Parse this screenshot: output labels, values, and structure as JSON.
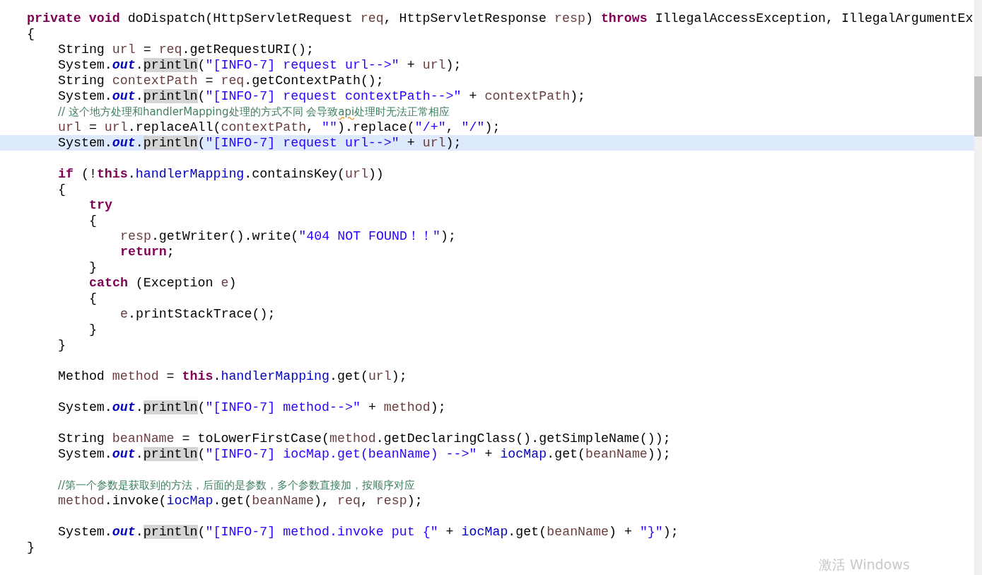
{
  "editor": {
    "lines": [
      {
        "tokens": [
          {
            "kind": "keyword",
            "text": "private void"
          },
          {
            "kind": "plain",
            "text": " doDispatch(HttpServletRequest "
          },
          {
            "kind": "local",
            "text": "req"
          },
          {
            "kind": "plain",
            "text": ", HttpServletResponse "
          },
          {
            "kind": "local",
            "text": "resp"
          },
          {
            "kind": "plain",
            "text": ") "
          },
          {
            "kind": "keyword",
            "text": "throws"
          },
          {
            "kind": "plain",
            "text": " IllegalAccessException, IllegalArgumentEx"
          }
        ],
        "current": false
      },
      {
        "tokens": [
          {
            "kind": "plain",
            "text": "{"
          }
        ],
        "current": false,
        "children": [
          {
            "tokens": [
              {
                "kind": "plain",
                "text": "String "
              },
              {
                "kind": "local",
                "text": "url"
              },
              {
                "kind": "plain",
                "text": " = "
              },
              {
                "kind": "local",
                "text": "req"
              },
              {
                "kind": "plain",
                "text": ".getRequestURI();"
              }
            ],
            "current": false
          },
          {
            "tokens": [
              {
                "kind": "plain",
                "text": "System."
              },
              {
                "kind": "field",
                "text": "out"
              },
              {
                "kind": "plain",
                "text": "."
              },
              {
                "kind": "occurrence",
                "text": "println"
              },
              {
                "kind": "plain",
                "text": "("
              },
              {
                "kind": "string",
                "text": "\"[INFO-7] request url-->\""
              },
              {
                "kind": "plain",
                "text": " + "
              },
              {
                "kind": "local",
                "text": "url"
              },
              {
                "kind": "plain",
                "text": ");"
              }
            ],
            "current": false
          },
          {
            "tokens": [
              {
                "kind": "plain",
                "text": "String "
              },
              {
                "kind": "local",
                "text": "contextPath"
              },
              {
                "kind": "plain",
                "text": " = "
              },
              {
                "kind": "local",
                "text": "req"
              },
              {
                "kind": "plain",
                "text": ".getContextPath();"
              }
            ],
            "current": false
          },
          {
            "tokens": [
              {
                "kind": "plain",
                "text": "System."
              },
              {
                "kind": "field",
                "text": "out"
              },
              {
                "kind": "plain",
                "text": "."
              },
              {
                "kind": "occurrence",
                "text": "println"
              },
              {
                "kind": "plain",
                "text": "("
              },
              {
                "kind": "string",
                "text": "\"[INFO-7] request contextPath-->\""
              },
              {
                "kind": "plain",
                "text": " + "
              },
              {
                "kind": "local",
                "text": "contextPath"
              },
              {
                "kind": "plain",
                "text": ");"
              }
            ],
            "current": false
          },
          {
            "tokens": [
              {
                "kind": "comment",
                "text": "// 这个地方处理和handlerMapping处理的方式不同 会导致"
              },
              {
                "kind": "misspelled",
                "text": "api"
              },
              {
                "kind": "comment",
                "text": "处理时无法正常相应"
              }
            ],
            "current": false
          },
          {
            "tokens": [
              {
                "kind": "local",
                "text": "url"
              },
              {
                "kind": "plain",
                "text": " = "
              },
              {
                "kind": "local",
                "text": "url"
              },
              {
                "kind": "plain",
                "text": ".replaceAll("
              },
              {
                "kind": "local",
                "text": "contextPath"
              },
              {
                "kind": "plain",
                "text": ", "
              },
              {
                "kind": "string",
                "text": "\"\""
              },
              {
                "kind": "plain",
                "text": ").replace("
              },
              {
                "kind": "string",
                "text": "\"/+\""
              },
              {
                "kind": "plain",
                "text": ", "
              },
              {
                "kind": "string",
                "text": "\"/\""
              },
              {
                "kind": "plain",
                "text": ");"
              }
            ],
            "current": false
          },
          {
            "tokens": [
              {
                "kind": "plain",
                "text": "System."
              },
              {
                "kind": "field",
                "text": "out"
              },
              {
                "kind": "plain",
                "text": "."
              },
              {
                "kind": "occurrence",
                "text": "println"
              },
              {
                "kind": "plain",
                "text": "("
              },
              {
                "kind": "string",
                "text": "\"[INFO-7] request url-->\""
              },
              {
                "kind": "plain",
                "text": " + "
              },
              {
                "kind": "local",
                "text": "url"
              },
              {
                "kind": "plain",
                "text": ");"
              }
            ],
            "current": true
          },
          {
            "kind": "blank"
          },
          {
            "tokens": [
              {
                "kind": "keyword",
                "text": "if"
              },
              {
                "kind": "plain",
                "text": " (!"
              },
              {
                "kind": "keyword",
                "text": "this"
              },
              {
                "kind": "plain",
                "text": "."
              },
              {
                "kind": "member",
                "text": "handlerMapping"
              },
              {
                "kind": "plain",
                "text": ".containsKey("
              },
              {
                "kind": "local",
                "text": "url"
              },
              {
                "kind": "plain",
                "text": "))"
              }
            ],
            "current": false
          },
          {
            "tokens": [
              {
                "kind": "plain",
                "text": "{"
              }
            ],
            "current": false,
            "children": [
              {
                "tokens": [
                  {
                    "kind": "keyword",
                    "text": "try"
                  }
                ],
                "current": false
              },
              {
                "tokens": [
                  {
                    "kind": "plain",
                    "text": "{"
                  }
                ],
                "current": false,
                "children": [
                  {
                    "tokens": [
                      {
                        "kind": "local",
                        "text": "resp"
                      },
                      {
                        "kind": "plain",
                        "text": ".getWriter().write("
                      },
                      {
                        "kind": "string",
                        "text": "\"404 NOT FOUND！！\""
                      },
                      {
                        "kind": "plain",
                        "text": ");"
                      }
                    ],
                    "current": false
                  },
                  {
                    "tokens": [
                      {
                        "kind": "keyword",
                        "text": "return"
                      },
                      {
                        "kind": "plain",
                        "text": ";"
                      }
                    ],
                    "current": false
                  }
                ]
              },
              {
                "tokens": [
                  {
                    "kind": "plain",
                    "text": "}"
                  }
                ],
                "current": false
              },
              {
                "tokens": [
                  {
                    "kind": "keyword",
                    "text": "catch"
                  },
                  {
                    "kind": "plain",
                    "text": " (Exception "
                  },
                  {
                    "kind": "local",
                    "text": "e"
                  },
                  {
                    "kind": "plain",
                    "text": ")"
                  }
                ],
                "current": false
              },
              {
                "tokens": [
                  {
                    "kind": "plain",
                    "text": "{"
                  }
                ],
                "current": false,
                "children": [
                  {
                    "tokens": [
                      {
                        "kind": "local",
                        "text": "e"
                      },
                      {
                        "kind": "plain",
                        "text": ".printStackTrace();"
                      }
                    ],
                    "current": false
                  }
                ]
              },
              {
                "tokens": [
                  {
                    "kind": "plain",
                    "text": "}"
                  }
                ],
                "current": false
              }
            ]
          },
          {
            "tokens": [
              {
                "kind": "plain",
                "text": "}"
              }
            ],
            "current": false
          },
          {
            "kind": "blank"
          },
          {
            "tokens": [
              {
                "kind": "plain",
                "text": "Method "
              },
              {
                "kind": "local",
                "text": "method"
              },
              {
                "kind": "plain",
                "text": " = "
              },
              {
                "kind": "keyword",
                "text": "this"
              },
              {
                "kind": "plain",
                "text": "."
              },
              {
                "kind": "member",
                "text": "handlerMapping"
              },
              {
                "kind": "plain",
                "text": ".get("
              },
              {
                "kind": "local",
                "text": "url"
              },
              {
                "kind": "plain",
                "text": ");"
              }
            ],
            "current": false
          },
          {
            "kind": "blank"
          },
          {
            "tokens": [
              {
                "kind": "plain",
                "text": "System."
              },
              {
                "kind": "field",
                "text": "out"
              },
              {
                "kind": "plain",
                "text": "."
              },
              {
                "kind": "occurrence",
                "text": "println"
              },
              {
                "kind": "plain",
                "text": "("
              },
              {
                "kind": "string",
                "text": "\"[INFO-7] method-->\""
              },
              {
                "kind": "plain",
                "text": " + "
              },
              {
                "kind": "local",
                "text": "method"
              },
              {
                "kind": "plain",
                "text": ");"
              }
            ],
            "current": false
          },
          {
            "kind": "blank"
          },
          {
            "tokens": [
              {
                "kind": "plain",
                "text": "String "
              },
              {
                "kind": "local",
                "text": "beanName"
              },
              {
                "kind": "plain",
                "text": " = toLowerFirstCase("
              },
              {
                "kind": "local",
                "text": "method"
              },
              {
                "kind": "plain",
                "text": ".getDeclaringClass().getSimpleName());"
              }
            ],
            "current": false
          },
          {
            "tokens": [
              {
                "kind": "plain",
                "text": "System."
              },
              {
                "kind": "field",
                "text": "out"
              },
              {
                "kind": "plain",
                "text": "."
              },
              {
                "kind": "occurrence",
                "text": "println"
              },
              {
                "kind": "plain",
                "text": "("
              },
              {
                "kind": "string",
                "text": "\"[INFO-7] iocMap.get(beanName) -->\""
              },
              {
                "kind": "plain",
                "text": " + "
              },
              {
                "kind": "member",
                "text": "iocMap"
              },
              {
                "kind": "plain",
                "text": ".get("
              },
              {
                "kind": "local",
                "text": "beanName"
              },
              {
                "kind": "plain",
                "text": "));"
              }
            ],
            "current": false
          },
          {
            "kind": "blank"
          },
          {
            "tokens": [
              {
                "kind": "comment",
                "text": "//第一个参数是获取到的方法，后面的是参数，多个参数直接加，按顺序对应"
              }
            ],
            "current": false
          },
          {
            "tokens": [
              {
                "kind": "local",
                "text": "method"
              },
              {
                "kind": "plain",
                "text": ".invoke("
              },
              {
                "kind": "member",
                "text": "iocMap"
              },
              {
                "kind": "plain",
                "text": ".get("
              },
              {
                "kind": "local",
                "text": "beanName"
              },
              {
                "kind": "plain",
                "text": "), "
              },
              {
                "kind": "local",
                "text": "req"
              },
              {
                "kind": "plain",
                "text": ", "
              },
              {
                "kind": "local",
                "text": "resp"
              },
              {
                "kind": "plain",
                "text": ");"
              }
            ],
            "current": false
          },
          {
            "kind": "blank"
          },
          {
            "tokens": [
              {
                "kind": "plain",
                "text": "System."
              },
              {
                "kind": "field",
                "text": "out"
              },
              {
                "kind": "plain",
                "text": "."
              },
              {
                "kind": "occurrence",
                "text": "println"
              },
              {
                "kind": "plain",
                "text": "("
              },
              {
                "kind": "string",
                "text": "\"[INFO-7] method.invoke put {\""
              },
              {
                "kind": "plain",
                "text": " + "
              },
              {
                "kind": "member",
                "text": "iocMap"
              },
              {
                "kind": "plain",
                "text": ".get("
              },
              {
                "kind": "local",
                "text": "beanName"
              },
              {
                "kind": "plain",
                "text": ") + "
              },
              {
                "kind": "string",
                "text": "\"}\""
              },
              {
                "kind": "plain",
                "text": ");"
              }
            ],
            "current": false
          }
        ]
      },
      {
        "tokens": [
          {
            "kind": "plain",
            "text": "}"
          }
        ],
        "current": false
      }
    ]
  },
  "os_notice": "激活 Windows"
}
